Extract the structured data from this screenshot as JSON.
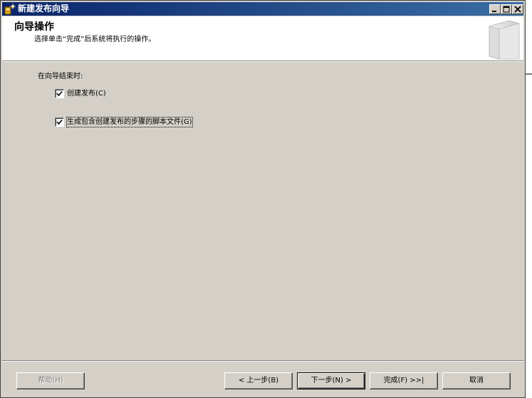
{
  "window": {
    "title": "新建发布向导",
    "controls": {
      "minimize": "minimize-icon",
      "maximize": "maximize-icon",
      "close": "close-icon"
    }
  },
  "header": {
    "title": "向导操作",
    "subtitle": "选择单击“完成”后系统将执行的操作。"
  },
  "content": {
    "group_label": "在向导结束时:",
    "options": [
      {
        "label": "创建发布(C)",
        "checked": true
      },
      {
        "label": "生成包含创建发布的步骤的脚本文件(G)",
        "checked": true
      }
    ]
  },
  "buttons": {
    "help": "帮助(H)",
    "back": "< 上一步(B)",
    "next": "下一步(N) >",
    "finish": "完成(F) >>|",
    "cancel": "取消"
  },
  "colors": {
    "titlebar_start": "#0a246a",
    "titlebar_end": "#3a6ea5",
    "dialog_face": "#d4d0c8"
  }
}
